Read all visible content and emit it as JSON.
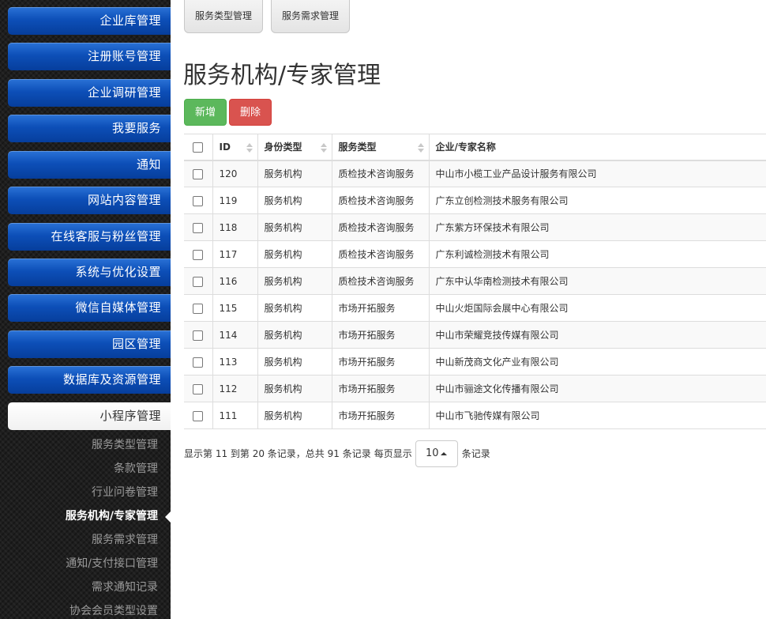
{
  "sidebar": {
    "menu": [
      {
        "label": "企业库管理"
      },
      {
        "label": "注册账号管理"
      },
      {
        "label": "企业调研管理"
      },
      {
        "label": "我要服务"
      },
      {
        "label": "通知"
      },
      {
        "label": "网站内容管理"
      },
      {
        "label": "在线客服与粉丝管理"
      },
      {
        "label": "系统与优化设置"
      },
      {
        "label": "微信自媒体管理"
      },
      {
        "label": "园区管理"
      },
      {
        "label": "数据库及资源管理"
      },
      {
        "label": "小程序管理"
      }
    ],
    "submenu": [
      {
        "label": "服务类型管理"
      },
      {
        "label": "条款管理"
      },
      {
        "label": "行业问卷管理"
      },
      {
        "label": "服务机构/专家管理"
      },
      {
        "label": "服务需求管理"
      },
      {
        "label": "通知/支付接口管理"
      },
      {
        "label": "需求通知记录"
      },
      {
        "label": "协会会员类型设置"
      }
    ]
  },
  "top_tabs": [
    {
      "label": "服务类型管理"
    },
    {
      "label": "服务需求管理"
    }
  ],
  "page_title": "服务机构/专家管理",
  "toolbar": {
    "add_label": "新增",
    "delete_label": "删除"
  },
  "table": {
    "columns": [
      "ID",
      "身份类型",
      "服务类型",
      "企业/专家名称"
    ],
    "rows": [
      {
        "id": "120",
        "identity": "服务机构",
        "service": "质检技术咨询服务",
        "name": "中山市小榄工业产品设计服务有限公司"
      },
      {
        "id": "119",
        "identity": "服务机构",
        "service": "质检技术咨询服务",
        "name": "广东立创检测技术服务有限公司"
      },
      {
        "id": "118",
        "identity": "服务机构",
        "service": "质检技术咨询服务",
        "name": "广东紫方环保技术有限公司"
      },
      {
        "id": "117",
        "identity": "服务机构",
        "service": "质检技术咨询服务",
        "name": "广东利诚检测技术有限公司"
      },
      {
        "id": "116",
        "identity": "服务机构",
        "service": "质检技术咨询服务",
        "name": "广东中认华南检测技术有限公司"
      },
      {
        "id": "115",
        "identity": "服务机构",
        "service": "市场开拓服务",
        "name": "中山火炬国际会展中心有限公司"
      },
      {
        "id": "114",
        "identity": "服务机构",
        "service": "市场开拓服务",
        "name": "中山市荣耀竞技传媒有限公司"
      },
      {
        "id": "113",
        "identity": "服务机构",
        "service": "市场开拓服务",
        "name": "中山新茂商文化产业有限公司"
      },
      {
        "id": "112",
        "identity": "服务机构",
        "service": "市场开拓服务",
        "name": "中山市骊途文化传播有限公司"
      },
      {
        "id": "111",
        "identity": "服务机构",
        "service": "市场开拓服务",
        "name": "中山市飞驰传媒有限公司"
      }
    ]
  },
  "pagination": {
    "summary": "显示第 11 到第 20 条记录，总共 91 条记录",
    "per_page_prefix": "每页显示",
    "page_size": "10",
    "per_page_suffix": "条记录"
  }
}
